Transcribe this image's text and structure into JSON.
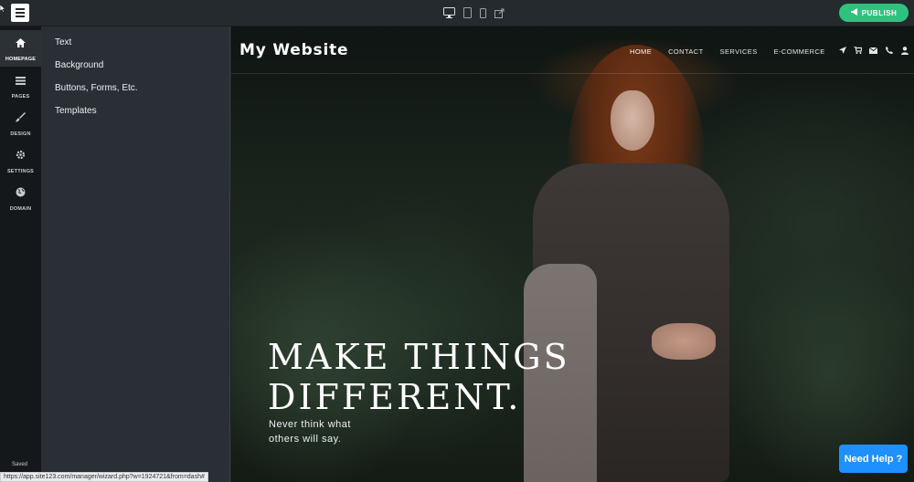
{
  "topbar": {
    "menu_icon": "hamburger-icon",
    "device_icons": [
      "desktop-icon",
      "tablet-icon",
      "mobile-icon",
      "external-link-icon"
    ],
    "publish_label": "PUBLISH",
    "publish_icon": "megaphone-icon",
    "publish_color": "#2ec27e"
  },
  "rail": {
    "items": [
      {
        "label": "HOMEPAGE",
        "icon": "home-icon",
        "active": true
      },
      {
        "label": "PAGES",
        "icon": "pages-icon",
        "active": false
      },
      {
        "label": "DESIGN",
        "icon": "brush-icon",
        "active": false
      },
      {
        "label": "SETTINGS",
        "icon": "gear-icon",
        "active": false
      },
      {
        "label": "DOMAIN",
        "icon": "globe-icon",
        "active": false
      }
    ],
    "status": "Saved"
  },
  "panel": {
    "items": [
      "Text",
      "Background",
      "Buttons, Forms, Etc.",
      "Templates"
    ]
  },
  "site": {
    "logo": "My Website",
    "nav": [
      "HOME",
      "CONTACT",
      "SERVICES",
      "E-COMMERCE"
    ],
    "nav_icons": [
      "send-icon",
      "cart-icon",
      "envelope-icon",
      "phone-icon",
      "user-icon"
    ],
    "hero_title_line1": "MAKE THINGS",
    "hero_title_line2": "DIFFERENT.",
    "hero_sub_line1": "Never think what",
    "hero_sub_line2": "others will say."
  },
  "help_label": "Need Help ?",
  "help_color": "#1e90ff",
  "status_url": "https://app.site123.com/manager/wizard.php?w=1924721&from=dash#"
}
